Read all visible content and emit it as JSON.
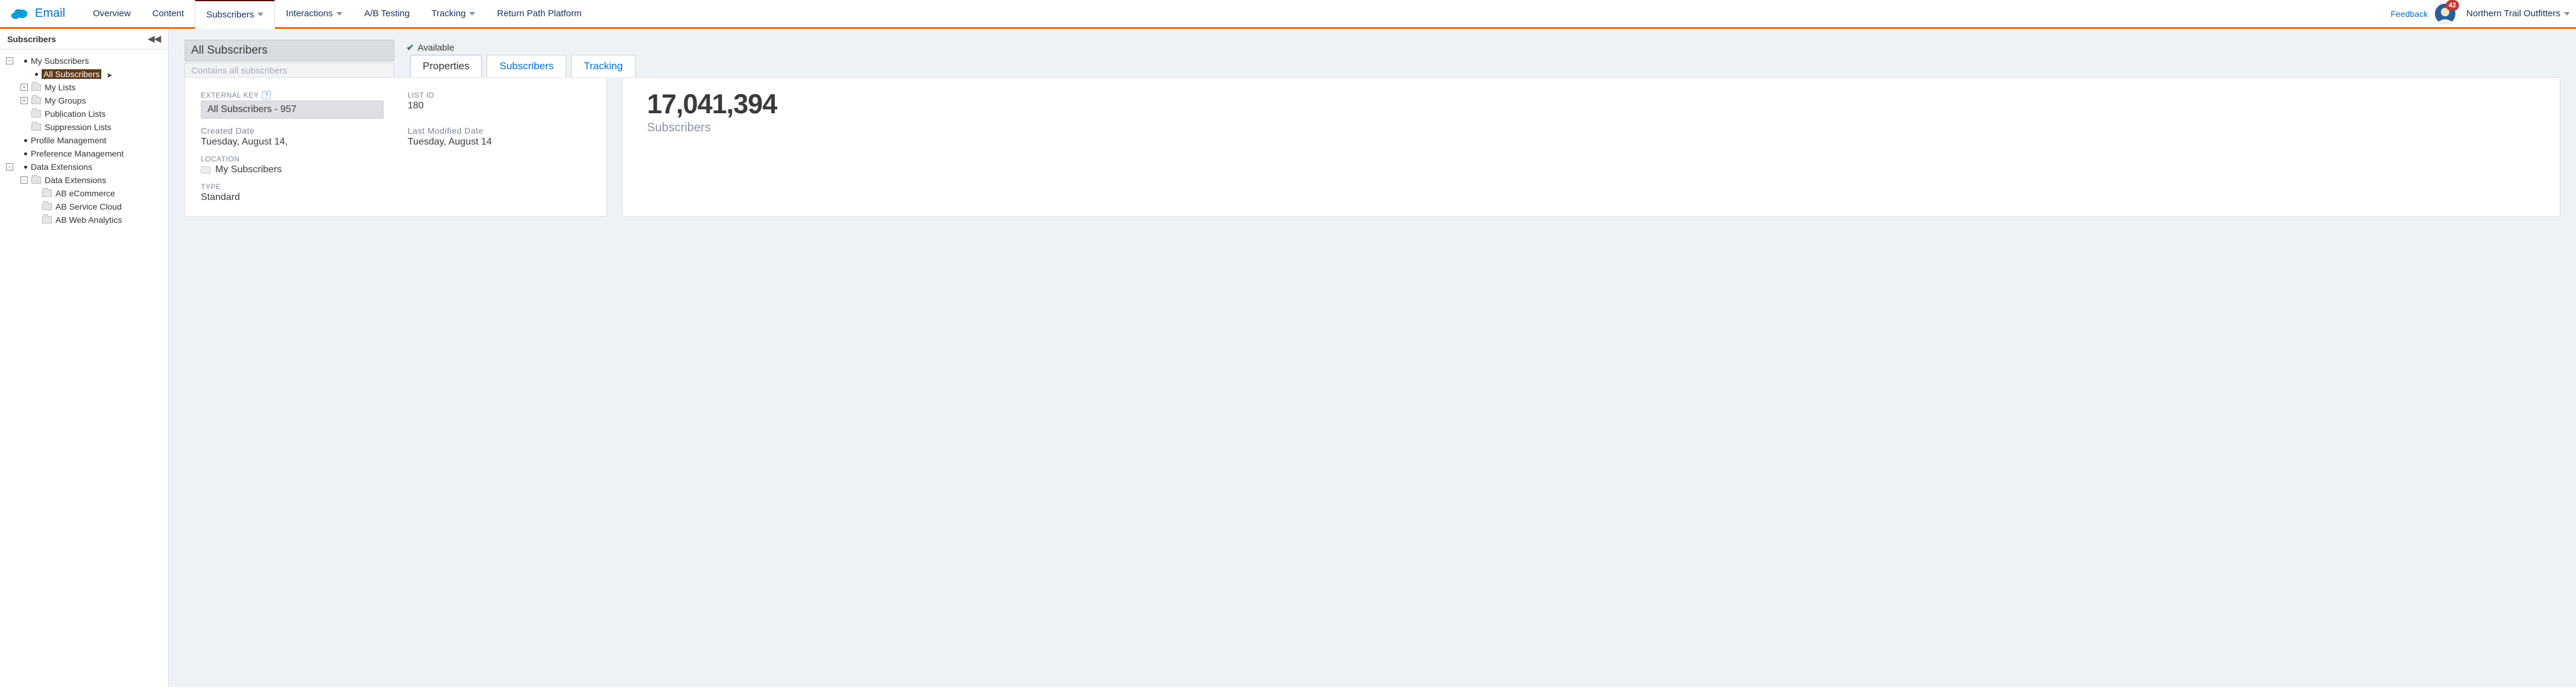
{
  "header": {
    "app": "Email",
    "feedback": "Feedback",
    "badge": "42",
    "account": "Northern Trail Outfitters",
    "tabs": [
      {
        "label": "Overview",
        "caret": false
      },
      {
        "label": "Content",
        "caret": false
      },
      {
        "label": "Subscribers",
        "caret": true,
        "active": true
      },
      {
        "label": "Interactions",
        "caret": true
      },
      {
        "label": "A/B Testing",
        "caret": false
      },
      {
        "label": "Tracking",
        "caret": true
      },
      {
        "label": "Return Path Platform",
        "caret": false
      }
    ]
  },
  "sidebar": {
    "title": "Subscribers",
    "tree": {
      "my_subscribers": "My Subscribers",
      "all_subscribers": "All Subscribers",
      "my_lists": "My Lists",
      "my_groups": "My Groups",
      "publication_lists": "Publication Lists",
      "suppression_lists": "Suppression Lists",
      "profile_management": "Profile Management",
      "preference_management": "Preference Management",
      "data_extensions_root": "Data Extensions",
      "data_extensions": "Data Extensions",
      "ab_ecommerce": "AB eCommerce",
      "ab_service_cloud": "AB Service Cloud",
      "ab_web_analytics": "AB Web Analytics"
    }
  },
  "main": {
    "title": "All Subscribers",
    "description": "Contains all subscribers",
    "status": "Available",
    "tabs": {
      "properties": "Properties",
      "subscribers": "Subscribers",
      "tracking": "Tracking"
    },
    "props": {
      "external_key_label": "EXTERNAL KEY",
      "external_key": "All Subscribers - 957",
      "list_id_label": "LIST ID",
      "list_id": "180",
      "created_label": "Created Date",
      "created": "Tuesday, August 14,",
      "modified_label": "Last Modified Date",
      "modified": "Tuesday, August 14",
      "location_label": "LOCATION",
      "location": "My Subscribers",
      "type_label": "TYPE",
      "type": "Standard"
    },
    "count": {
      "value": "17,041,394",
      "label": "Subscribers"
    }
  }
}
